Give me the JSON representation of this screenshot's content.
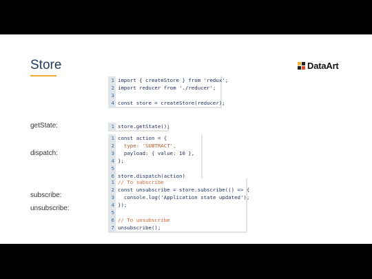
{
  "slide": {
    "title": "Store",
    "logo_text": "DataArt",
    "labels": {
      "getstate": "getState:",
      "dispatch": "dispatch:",
      "subscribe": "subscribe:",
      "unsubscribe": "unsubscribe:"
    }
  },
  "code": {
    "block1": [
      "import { createStore } from 'redux';",
      "import reducer from './reducer';",
      "",
      "const store = createStore(reducer);"
    ],
    "block2": [
      "store.getState();"
    ],
    "block3": [
      "const action = {",
      "  type: 'SUBTRACT',",
      "  payload: { value: 10 },",
      "};",
      "",
      "store.dispatch(action)"
    ],
    "block4": [
      "// To subscribe",
      "const unsubscribe = store.subscribe(() => {",
      "  console.log('Application state updated');",
      "});",
      "",
      "// To unsubscribe",
      "unsubscribe();"
    ]
  },
  "colors": {
    "accent": "#f0a830",
    "title": "#1f3b57",
    "gutter": "#dde4ea"
  }
}
